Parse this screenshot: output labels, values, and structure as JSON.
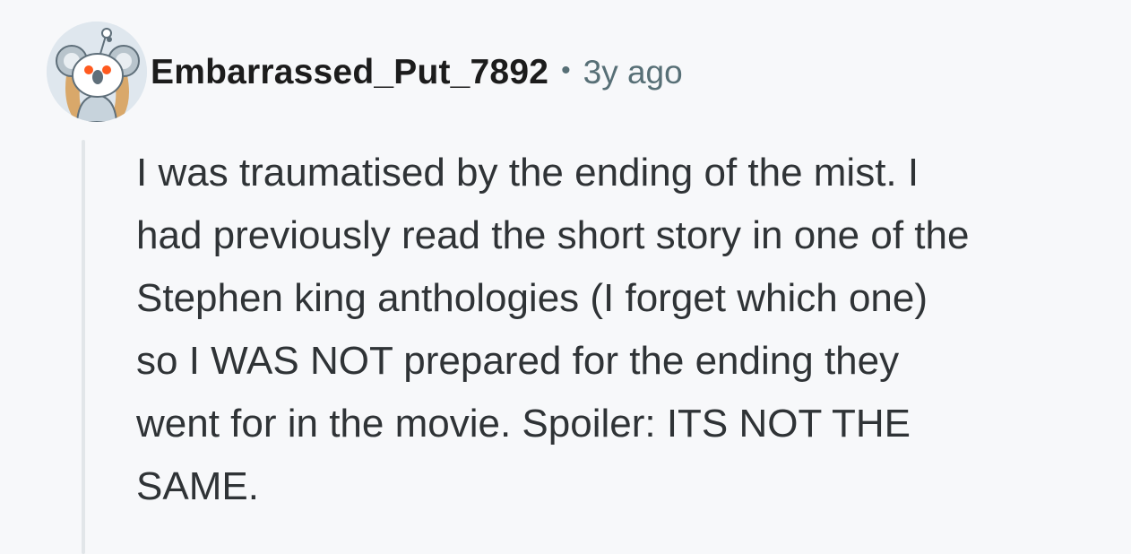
{
  "comment": {
    "author": "Embarrassed_Put_7892",
    "separator": "•",
    "age": "3y ago",
    "avatar_icon": "snoo-koala-avatar-icon",
    "body_lines": [
      "I was traumatised by the ending of the mist. I",
      "had previously read the short story in one of the",
      "Stephen king anthologies (I forget which one)",
      "so I WAS NOT prepared for the ending they",
      "went for in the movie. Spoiler: ITS NOT THE",
      "SAME."
    ]
  },
  "colors": {
    "background": "#f7f8fa",
    "text": "#2f3336",
    "meta": "#576f76",
    "thread_line": "#e2e6e9"
  }
}
